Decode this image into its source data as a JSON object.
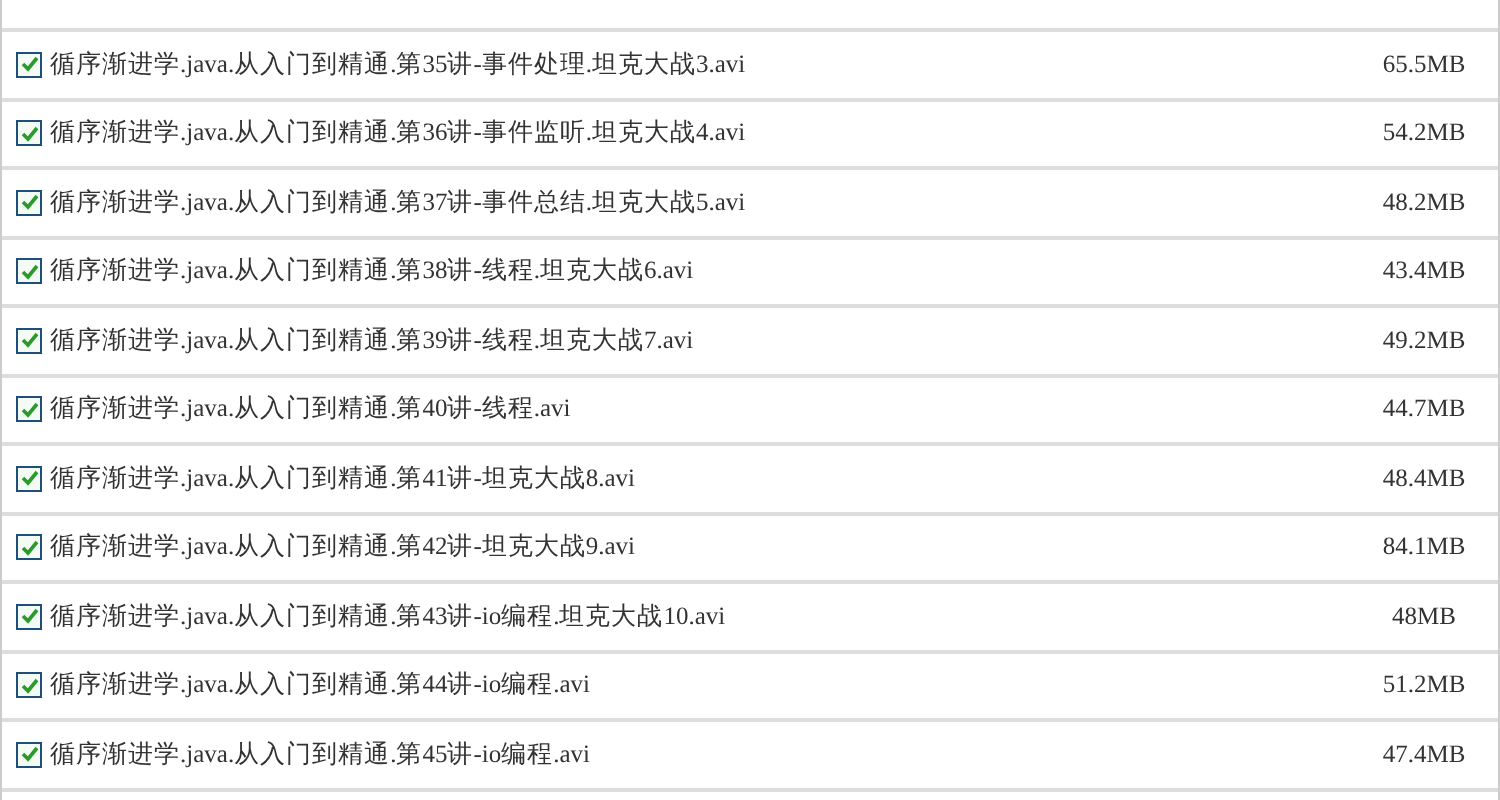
{
  "files": [
    {
      "name": "循序渐进学.java.从入门到精通.第35讲-事件处理.坦克大战3.avi",
      "size": "65.5MB",
      "checked": true
    },
    {
      "name": "循序渐进学.java.从入门到精通.第36讲-事件监听.坦克大战4.avi",
      "size": "54.2MB",
      "checked": true
    },
    {
      "name": "循序渐进学.java.从入门到精通.第37讲-事件总结.坦克大战5.avi",
      "size": "48.2MB",
      "checked": true
    },
    {
      "name": "循序渐进学.java.从入门到精通.第38讲-线程.坦克大战6.avi",
      "size": "43.4MB",
      "checked": true
    },
    {
      "name": "循序渐进学.java.从入门到精通.第39讲-线程.坦克大战7.avi",
      "size": "49.2MB",
      "checked": true
    },
    {
      "name": "循序渐进学.java.从入门到精通.第40讲-线程.avi",
      "size": "44.7MB",
      "checked": true
    },
    {
      "name": "循序渐进学.java.从入门到精通.第41讲-坦克大战8.avi",
      "size": "48.4MB",
      "checked": true
    },
    {
      "name": "循序渐进学.java.从入门到精通.第42讲-坦克大战9.avi",
      "size": "84.1MB",
      "checked": true
    },
    {
      "name": "循序渐进学.java.从入门到精通.第43讲-io编程.坦克大战10.avi",
      "size": "48MB",
      "checked": true
    },
    {
      "name": "循序渐进学.java.从入门到精通.第44讲-io编程.avi",
      "size": "51.2MB",
      "checked": true
    },
    {
      "name": "循序渐进学.java.从入门到精通.第45讲-io编程.avi",
      "size": "47.4MB",
      "checked": true
    }
  ]
}
